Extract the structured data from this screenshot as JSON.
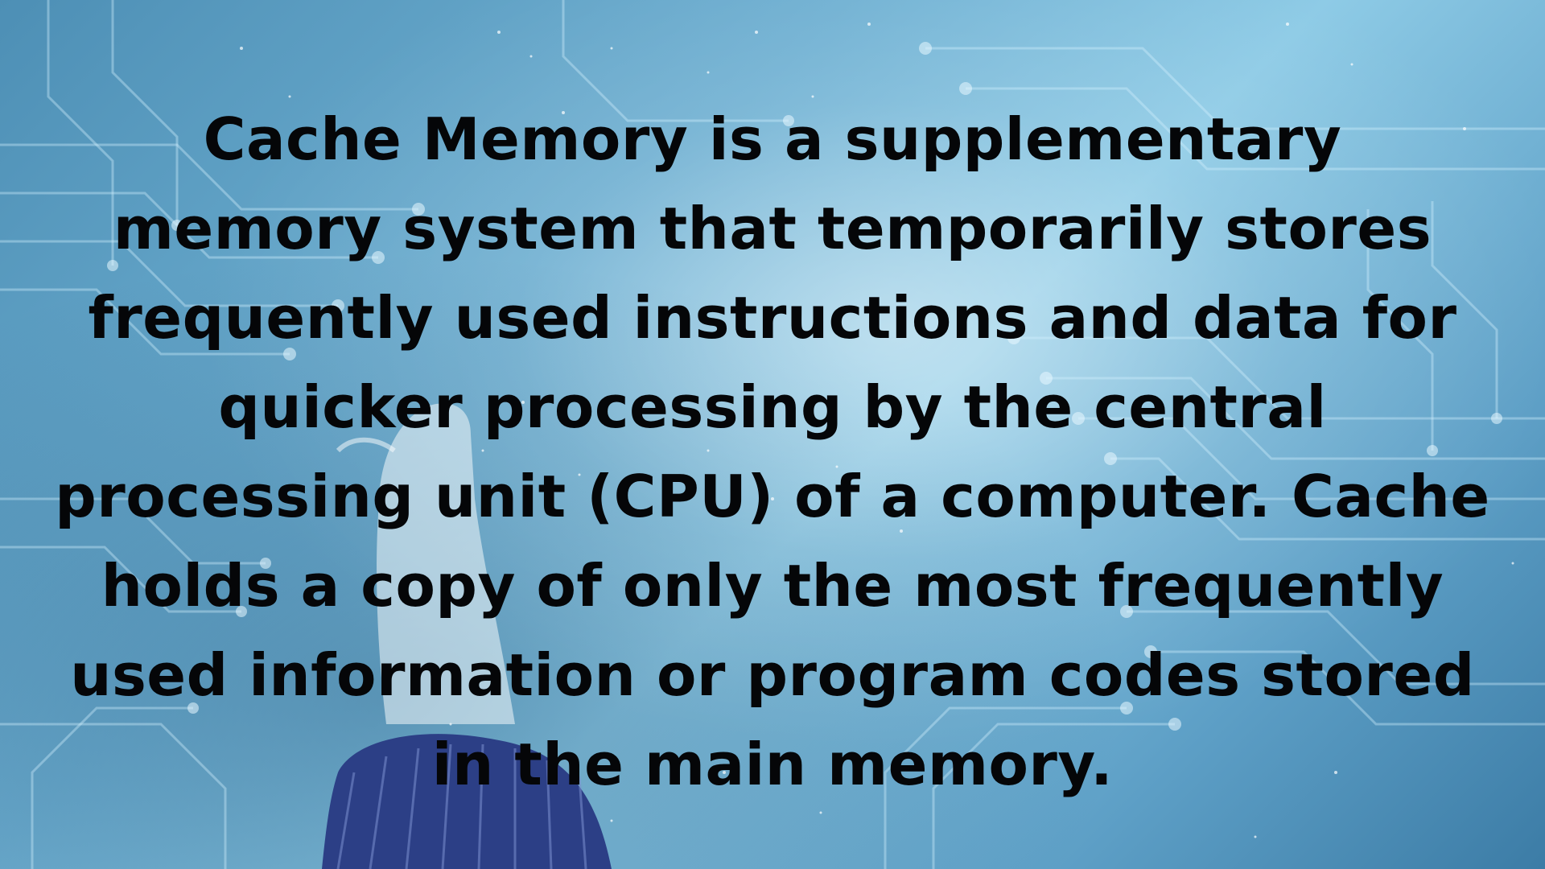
{
  "caption": {
    "lines": [
      "Cache  Memory is a supplementary",
      "memory system that temporarily stores",
      "frequently used instructions and data for",
      "quicker processing by the central",
      "processing unit (CPU) of a computer. Cache",
      "holds a copy of only the most frequently",
      "used information or program codes stored",
      "in the main memory."
    ]
  },
  "colors": {
    "text": "#050608",
    "background_light": "#8ecbe6",
    "background_dark": "#3c7ca6",
    "circuit_lines": "#d6f1ff",
    "sleeve": "#2c3f86"
  }
}
